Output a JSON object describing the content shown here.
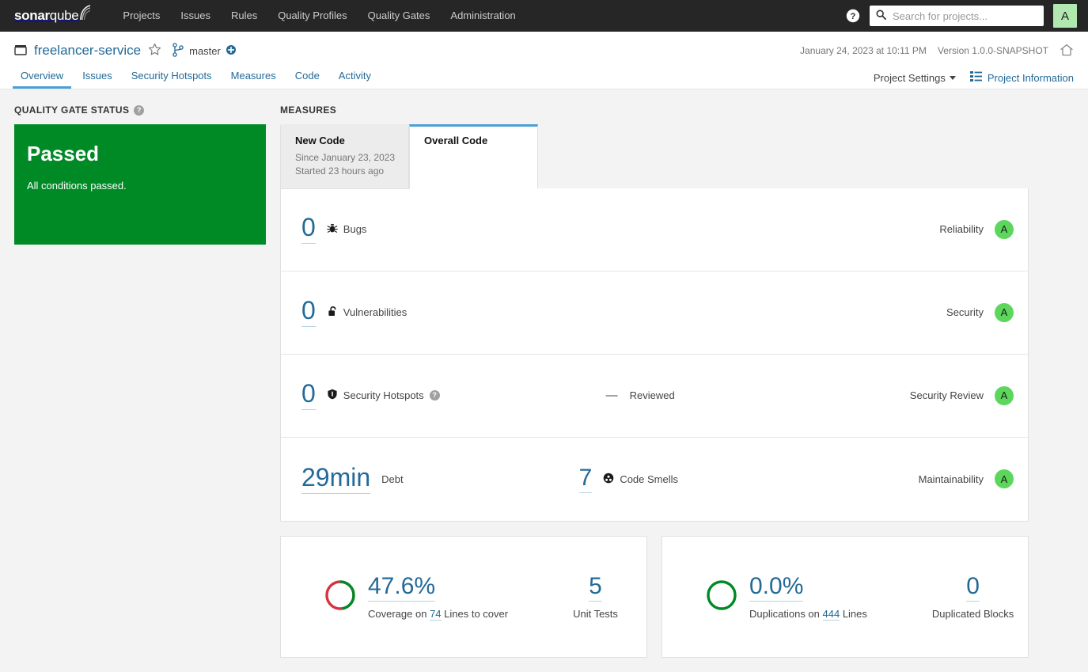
{
  "global_nav": {
    "logo_text_bold": "sonar",
    "logo_text_light": "qube",
    "links": [
      {
        "label": "Projects"
      },
      {
        "label": "Issues"
      },
      {
        "label": "Rules"
      },
      {
        "label": "Quality Profiles"
      },
      {
        "label": "Quality Gates"
      },
      {
        "label": "Administration"
      }
    ],
    "help_icon": "help-circle-icon",
    "search": {
      "placeholder": "Search for projects...",
      "value": "",
      "icon": "search-icon"
    },
    "avatar_initial": "A",
    "avatar_color": "#b0e8b0"
  },
  "project_header": {
    "project_icon": "project-box-icon",
    "project_name": "freelancer-service",
    "favorite_icon": "star-outline-icon",
    "branch_icon": "branch-icon",
    "branch_name": "master",
    "branch_badge_icon": "plus-circle-icon",
    "analysis_date": "January 24, 2023 at 10:11 PM",
    "version": "Version 1.0.0-SNAPSHOT",
    "home_icon": "home-icon"
  },
  "project_tabs": {
    "items": [
      {
        "label": "Overview",
        "active": true
      },
      {
        "label": "Issues",
        "active": false
      },
      {
        "label": "Security Hotspots",
        "active": false
      },
      {
        "label": "Measures",
        "active": false
      },
      {
        "label": "Code",
        "active": false
      },
      {
        "label": "Activity",
        "active": false
      }
    ],
    "project_settings_label": "Project Settings",
    "project_information_label": "Project Information",
    "project_information_icon": "list-icon"
  },
  "quality_gate": {
    "section_title": "QUALITY GATE STATUS",
    "help_icon": "help-circle-icon",
    "status": "Passed",
    "description": "All conditions passed.",
    "color": "#008a26"
  },
  "measures": {
    "section_title": "MEASURES",
    "tabs": [
      {
        "title": "New Code",
        "line1": "Since January 23, 2023",
        "line2": "Started 23 hours ago",
        "active": false
      },
      {
        "title": "Overall Code",
        "line1": "",
        "line2": "",
        "active": true
      }
    ],
    "rows": [
      {
        "value": "0",
        "label": "Bugs",
        "icon": "bug-icon",
        "rating_label": "Reliability",
        "rating": "A",
        "rating_color": "#5cd75c"
      },
      {
        "value": "0",
        "label": "Vulnerabilities",
        "icon": "open-lock-icon",
        "rating_label": "Security",
        "rating": "A",
        "rating_color": "#5cd75c"
      },
      {
        "value": "0",
        "label": "Security Hotspots",
        "icon": "shield-icon",
        "help_icon": "help-circle-icon",
        "secondary_value": "—",
        "secondary_label": "Reviewed",
        "rating_label": "Security Review",
        "rating": "A",
        "rating_color": "#5cd75c"
      },
      {
        "value": "29min",
        "label": "Debt",
        "icon": "",
        "secondary_value": "7",
        "secondary_label": "Code Smells",
        "secondary_icon": "code-smell-icon",
        "rating_label": "Maintainability",
        "rating": "A",
        "rating_color": "#5cd75c"
      }
    ]
  },
  "coverage_card": {
    "donut": {
      "percent": 47.6,
      "fill_color": "#008a26",
      "empty_color": "#d4333f"
    },
    "value": "47.6%",
    "caption_prefix": "Coverage on ",
    "caption_link": "74",
    "caption_suffix": " Lines to cover",
    "secondary_value": "5",
    "secondary_label": "Unit Tests"
  },
  "duplications_card": {
    "donut": {
      "percent": 0,
      "fill_color": "#008a26",
      "empty_color": "#008a26"
    },
    "value": "0.0%",
    "caption_prefix": "Duplications on ",
    "caption_link": "444",
    "caption_suffix": " Lines",
    "secondary_value": "0",
    "secondary_label": "Duplicated Blocks"
  }
}
